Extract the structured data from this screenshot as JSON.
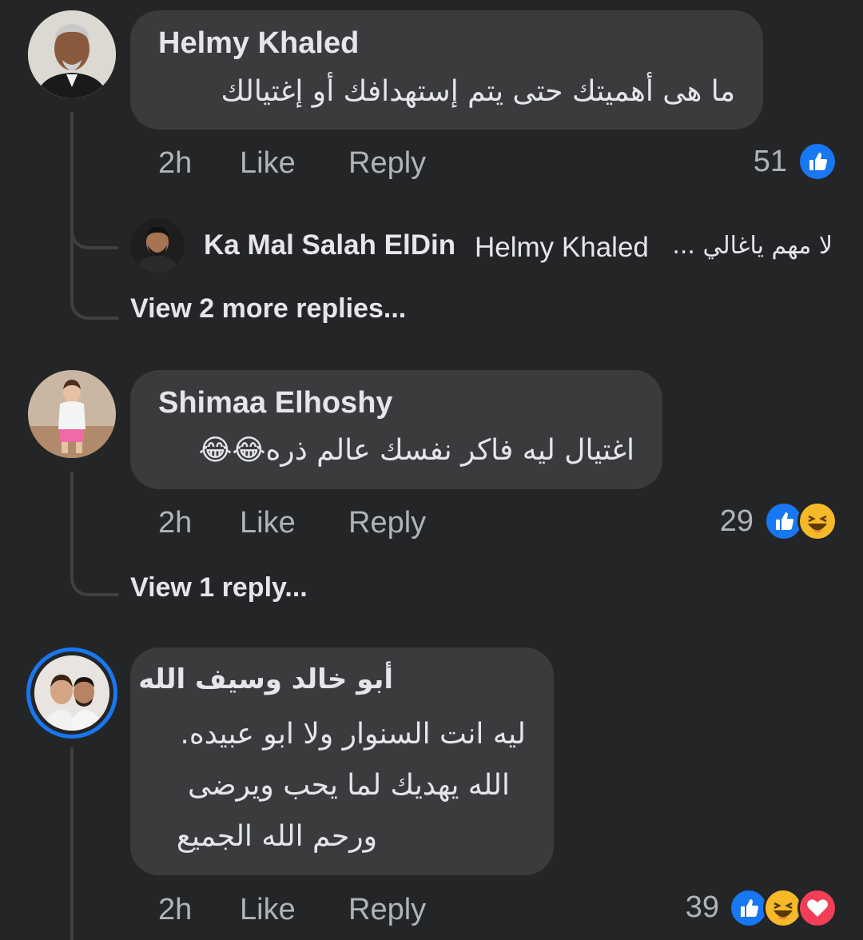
{
  "comments": [
    {
      "author": "Helmy Khaled",
      "text": "ما هى أهميتك حتى يتم إستهدافك أو إغتيالك",
      "time": "2h",
      "like_label": "Like",
      "reply_label": "Reply",
      "reaction_count": "51",
      "reactions": [
        "like-icon"
      ],
      "reply_preview": {
        "author": "Ka Mal Salah ElDin",
        "mention": "Helmy Khaled",
        "text": "لا مهم ياغالي ..."
      },
      "view_replies": "View 2 more replies..."
    },
    {
      "author": "Shimaa Elhoshy",
      "text": "اغتيال ليه فاكر نفسك عالم ذره😂😂",
      "time": "2h",
      "like_label": "Like",
      "reply_label": "Reply",
      "reaction_count": "29",
      "reactions": [
        "like-icon",
        "haha-icon"
      ],
      "view_replies": "View 1 reply..."
    },
    {
      "author": "أبو خالد وسيف الله",
      "text_lines": [
        "ليه انت السنوار ولا ابو عبيده.",
        "الله يهديك لما يحب ويرضى",
        "ورحم الله الجميع"
      ],
      "time": "2h",
      "like_label": "Like",
      "reply_label": "Reply",
      "reaction_count": "39",
      "reactions": [
        "like-icon",
        "haha-icon",
        "love-icon"
      ]
    }
  ],
  "colors": {
    "background": "#242526",
    "bubble": "#3a3b3c",
    "text": "#e4e6eb",
    "secondary": "#b0b3b8",
    "like_blue": "#1877f2",
    "haha_yellow": "#f7b928",
    "love_red": "#f33e58",
    "story_ring": "#1877f2"
  }
}
